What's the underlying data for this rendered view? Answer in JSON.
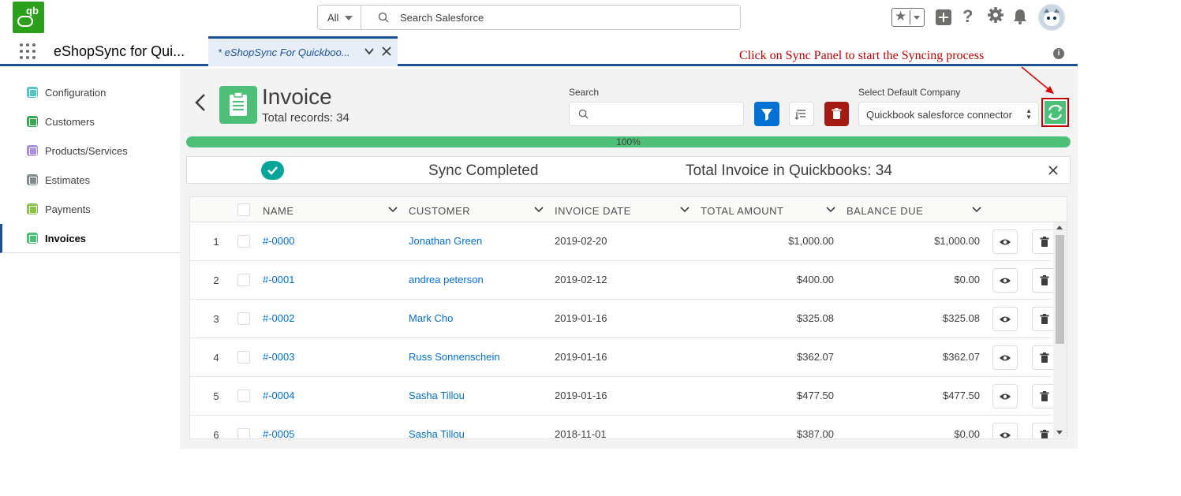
{
  "header": {
    "logo_text": "qb",
    "search_scope": "All",
    "search_placeholder": "Search Salesforce"
  },
  "nav": {
    "app_name": "eShopSync for Qui...",
    "tab_label": "* eShopSync For Quickboo..."
  },
  "annotation": {
    "text": "Click on Sync Panel to start the Syncing process",
    "color": "#c00000"
  },
  "sidebar": {
    "items": [
      {
        "label": "Configuration",
        "color": "#54c5c5"
      },
      {
        "label": "Customers",
        "color": "#3ba755"
      },
      {
        "label": "Products/Services",
        "color": "#a98de0"
      },
      {
        "label": "Estimates",
        "color": "#7f8c8d"
      },
      {
        "label": "Payments",
        "color": "#8bc34a"
      },
      {
        "label": "Invoices",
        "color": "#4bc076",
        "active": true
      }
    ]
  },
  "page": {
    "title": "Invoice",
    "record_count": "Total records: 34",
    "search_label": "Search",
    "search_value": "",
    "company_label": "Select Default Company",
    "company_value": "Quickbook salesforce connector",
    "progress_percent": 100,
    "progress_text": "100%"
  },
  "sync": {
    "status": "Sync Completed",
    "total": "Total Invoice in Quickbooks: 34"
  },
  "table": {
    "columns": [
      "NAME",
      "CUSTOMER",
      "INVOICE DATE",
      "TOTAL AMOUNT",
      "BALANCE DUE"
    ],
    "rows": [
      {
        "num": "1",
        "name": "#-0000",
        "customer": "Jonathan Green",
        "date": "2019-02-20",
        "amount": "$1,000.00",
        "balance": "$1,000.00"
      },
      {
        "num": "2",
        "name": "#-0001",
        "customer": "andrea peterson",
        "date": "2019-02-12",
        "amount": "$400.00",
        "balance": "$0.00"
      },
      {
        "num": "3",
        "name": "#-0002",
        "customer": "Mark Cho",
        "date": "2019-01-16",
        "amount": "$325.08",
        "balance": "$325.08"
      },
      {
        "num": "4",
        "name": "#-0003",
        "customer": "Russ Sonnenschein",
        "date": "2019-01-16",
        "amount": "$362.07",
        "balance": "$362.07"
      },
      {
        "num": "5",
        "name": "#-0004",
        "customer": "Sasha Tillou",
        "date": "2019-01-16",
        "amount": "$477.50",
        "balance": "$477.50"
      },
      {
        "num": "6",
        "name": "#-0005",
        "customer": "Sasha Tillou",
        "date": "2018-11-01",
        "amount": "$387.00",
        "balance": "$0.00"
      }
    ]
  },
  "colors": {
    "brand_blue": "#1b5297",
    "link": "#0070d2",
    "success": "#4bc076",
    "danger": "#a61a14"
  }
}
